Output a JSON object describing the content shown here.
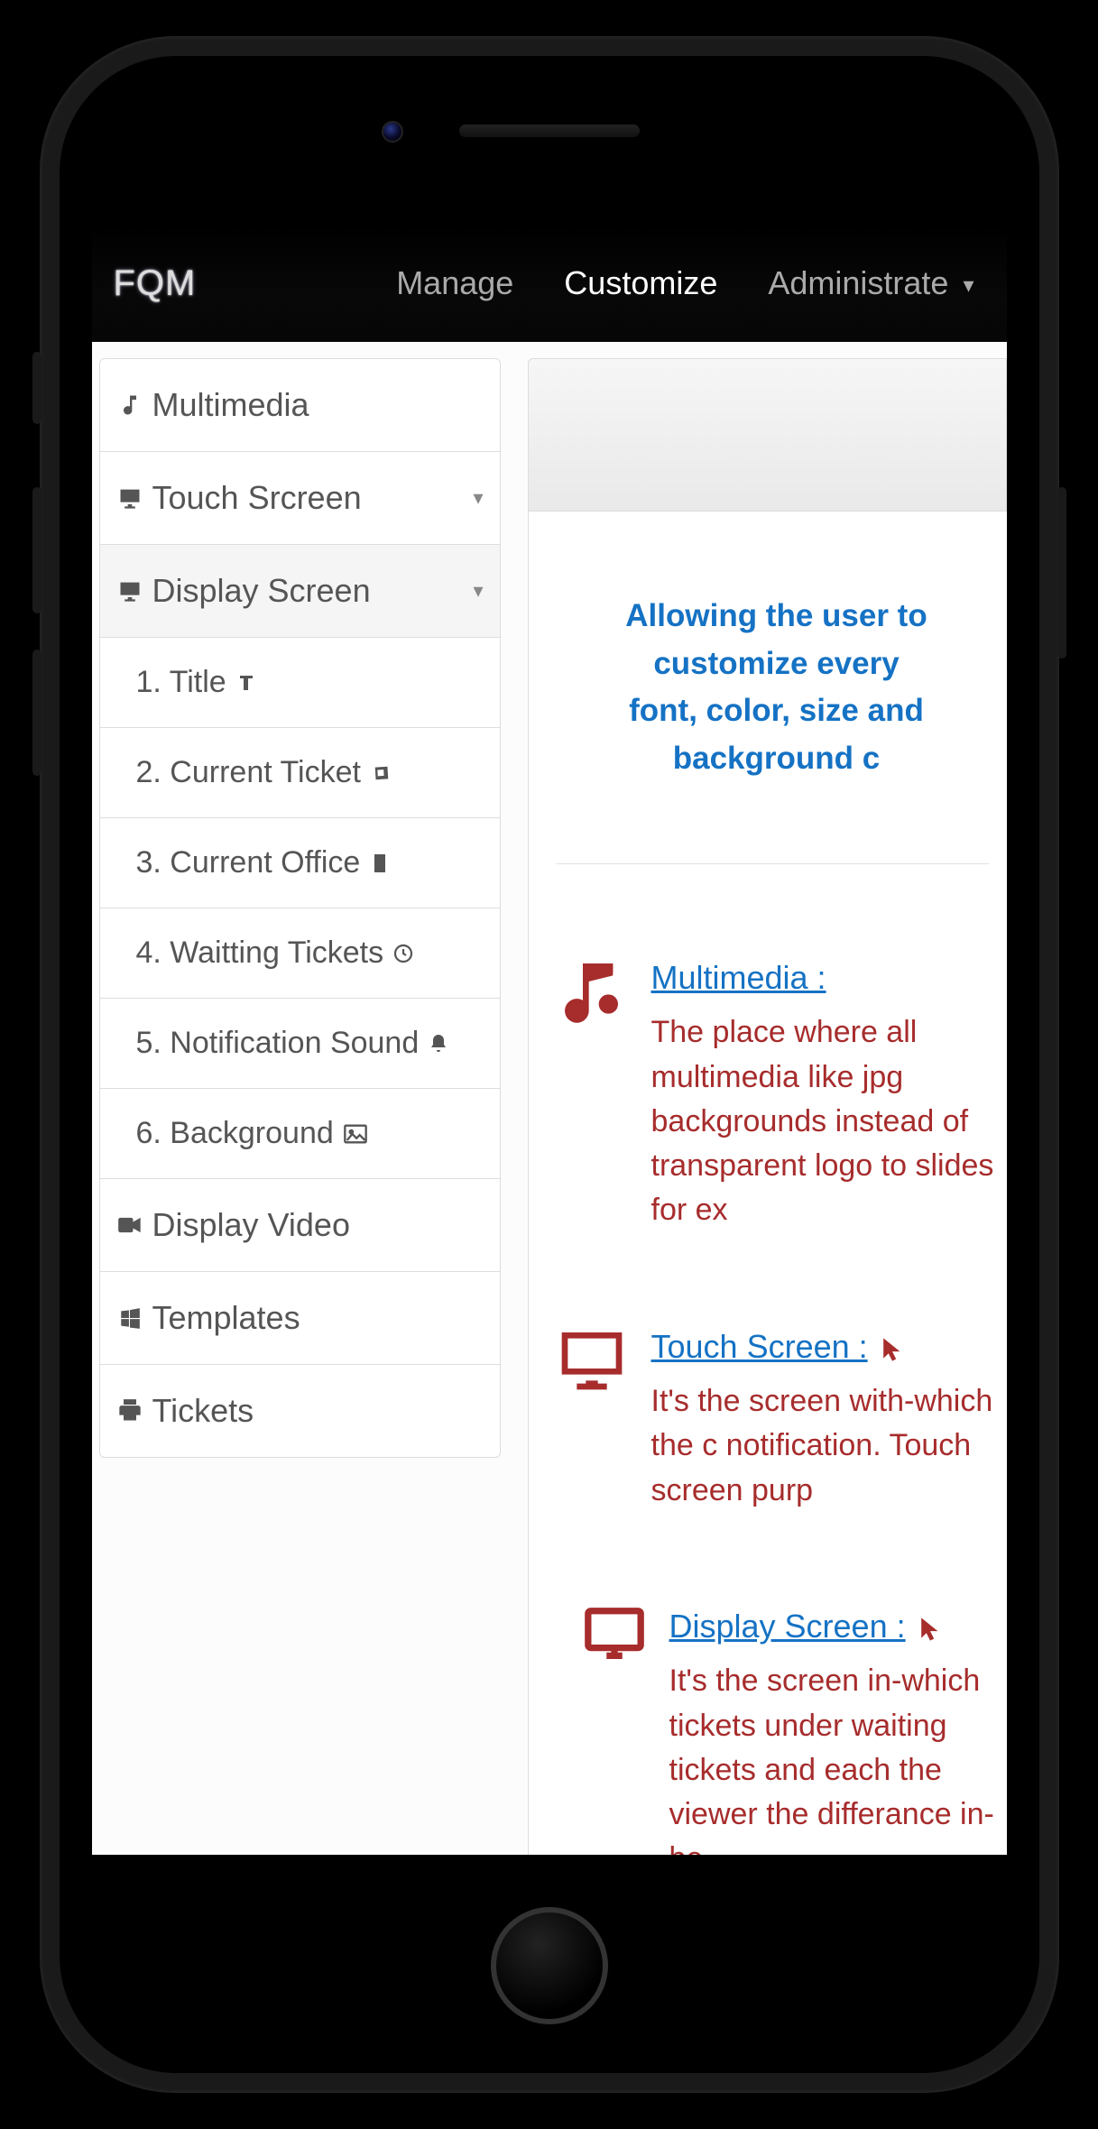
{
  "brand": "FQM",
  "nav": {
    "items": [
      {
        "label": "Manage",
        "active": false
      },
      {
        "label": "Customize",
        "active": true
      },
      {
        "label": "Administrate",
        "active": false,
        "dropdown": true
      }
    ]
  },
  "sidebar": {
    "multimedia": "Multimedia",
    "touch_screen": "Touch Srcreen",
    "display_screen": "Display Screen",
    "display_items": [
      "1. Title",
      "2. Current Ticket",
      "3. Current Office",
      "4. Waitting Tickets",
      "5. Notification Sound",
      "6. Background"
    ],
    "display_video": "Display Video",
    "templates": "Templates",
    "tickets": "Tickets"
  },
  "main": {
    "intro_line1": "Allowing the user to customize every",
    "intro_line2": "font, color, size and background c",
    "sections": [
      {
        "title": "Multimedia :",
        "desc": "The place where all multimedia like jpg backgrounds instead of transparent logo to slides for ex"
      },
      {
        "title": "Touch Screen :",
        "desc": "It's the screen with-which the c notification. Touch screen purp",
        "cursor": true
      },
      {
        "title": "Display Screen :",
        "desc": "It's the screen in-which tickets under waiting tickets and each the viewer the differance in-be",
        "cursor": true
      }
    ]
  }
}
